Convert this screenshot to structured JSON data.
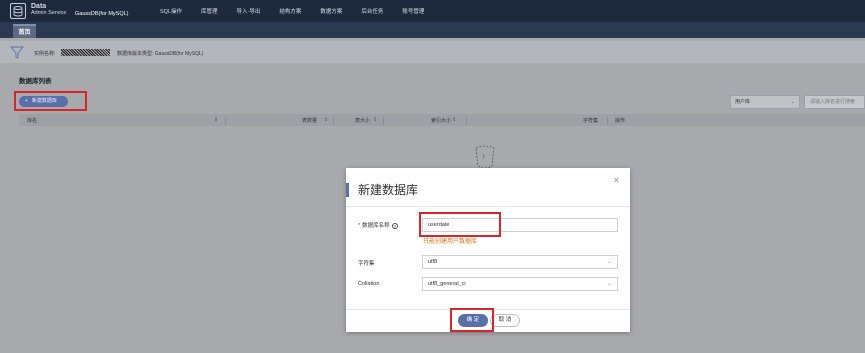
{
  "header": {
    "logo_line1": "Data",
    "logo_line2": "Admin Service",
    "instance": "GaussDB(for MySQL)",
    "nav": [
      "SQL操作",
      "库管理",
      "导入·导出",
      "结构方案",
      "数据方案",
      "后台任务",
      "账号管理"
    ]
  },
  "tabs": {
    "home": "首页"
  },
  "info": {
    "instance_label": "实例名称:",
    "db_type": "数据库版本类型: GaussDB(for MySQL)"
  },
  "list": {
    "title": "数据库列表",
    "new_button": "新建数据库",
    "user_select": "用户库",
    "search_placeholder": "请输入库名进行搜索",
    "columns": [
      "库名",
      "表数量",
      "表大小",
      "索引大小",
      "字符集",
      "操作"
    ]
  },
  "dialog": {
    "title": "新建数据库",
    "name_label": "数据库名称",
    "name_value": "userdate",
    "name_hint": "只能创建用户数据库",
    "charset_label": "字符集",
    "charset_value": "utf8",
    "collation_label": "Collation",
    "collation_value": "utf8_general_ci",
    "ok": "确 定",
    "cancel": "取 消"
  },
  "colors": {
    "accent": "#5a6fa7",
    "highlight": "#d6262b",
    "hint": "#e37318"
  }
}
